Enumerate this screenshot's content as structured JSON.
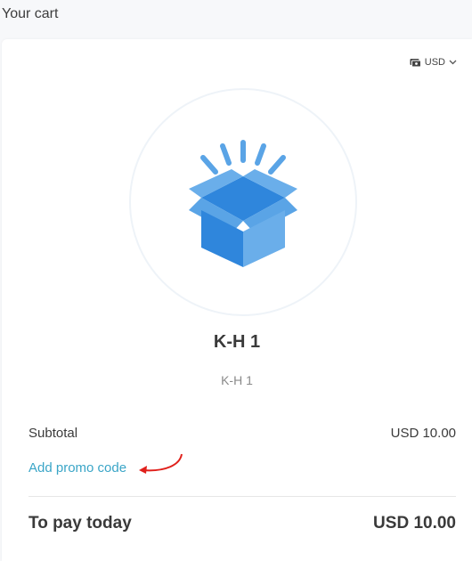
{
  "page": {
    "title": "Your cart"
  },
  "currency": {
    "selected": "USD"
  },
  "product": {
    "name": "K-H 1",
    "variant": "K-H 1",
    "icon": "open-box-icon"
  },
  "summary": {
    "subtotal_label": "Subtotal",
    "subtotal_value": "USD 10.00",
    "promo_label": "Add promo code",
    "total_label": "To pay today",
    "total_value": "USD 10.00"
  },
  "colors": {
    "accent": "#3aa5c7",
    "box_blue": "#2f86dc",
    "box_light": "#6aaeea",
    "arrow_red": "#e0201b"
  }
}
